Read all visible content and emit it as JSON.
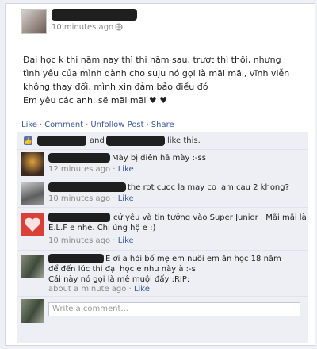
{
  "post": {
    "time": "10 minutes ago",
    "globe_icon": "globe-icon",
    "text": "Đại học k thi năm nay thì thi năm sau, trượt thì thôi, nhưng tình yêu của mình dành cho suju nó gọi là mãi mãi, vĩnh viễn không thay đổi, mình xin đảm bảo điều đó\nEm yêu các anh. sẽ mãi mãi ♥ ♥",
    "actions": {
      "like": "Like",
      "comment": "Comment",
      "unfollow": "Unfollow Post",
      "share": "Share",
      "separator": "·"
    }
  },
  "likes": {
    "and": "and",
    "suffix": "like this."
  },
  "comments": [
    {
      "text": "Mày bị điên hả mày :-ss",
      "time": "12 minutes ago",
      "like": "Like"
    },
    {
      "text": "the rot cuoc la may co lam cau 2 khong?",
      "time": "10 minutes ago",
      "like": "Like"
    },
    {
      "text": "cứ yêu và tin tưởng vào Super Junior . Mãi mãi là\nE.L.F e nhé. Chị ủng hộ e :)",
      "time": "10 minutes ago",
      "like": "Like"
    },
    {
      "text": "E ơi a hỏi bố mẹ em nuôi em ăn học 18 năm\nđể đến lúc thi đại học e như này à :-s\nCái này nó gọi là mê muội đấy :RIP:",
      "time": "about a minute ago",
      "like": "Like"
    }
  ],
  "write": {
    "placeholder": "Write a comment..."
  },
  "meta_separator": "·"
}
